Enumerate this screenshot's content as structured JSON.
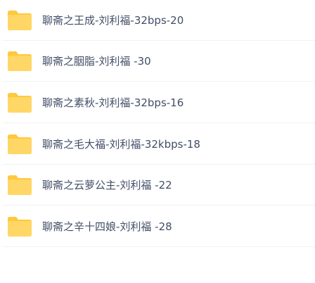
{
  "theme": {
    "folder_color": "#FFD766",
    "folder_tab_color": "#FFC83D",
    "text_color": "#424E67"
  },
  "files": [
    {
      "icon": "folder-icon",
      "name": "聊斋之王成-刘利福-32bps-20"
    },
    {
      "icon": "folder-icon",
      "name": "聊斋之胭脂-刘利福 -30"
    },
    {
      "icon": "folder-icon",
      "name": "聊斋之素秋-刘利福-32bps-16"
    },
    {
      "icon": "folder-icon",
      "name": "聊斋之毛大福-刘利福-32kbps-18"
    },
    {
      "icon": "folder-icon",
      "name": "聊斋之云萝公主-刘利福 -22"
    },
    {
      "icon": "folder-icon",
      "name": "聊斋之辛十四娘-刘利福 -28"
    }
  ]
}
